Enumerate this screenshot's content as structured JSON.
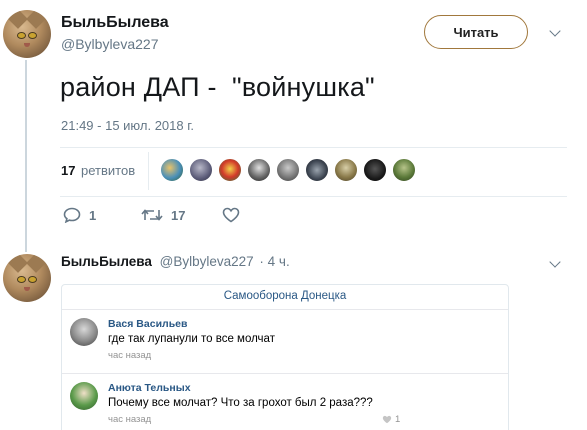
{
  "tweet": {
    "author_name": "БыльБылева",
    "author_handle": "@Bylbyleva227",
    "follow_label": "Читать",
    "text": "район ДАП -  \"войнушка\"",
    "timestamp": "21:49 - 15 июл. 2018 г.",
    "retweet_count": "17",
    "retweet_label": "ретвитов",
    "reply_count": "1",
    "retweets_action_count": "17",
    "retweeter_avatar_count_shown": 9
  },
  "reply": {
    "author_name": "БыльБылева",
    "author_handle": "@Bylbyleva227",
    "age": "· 4 ч.",
    "card": {
      "group_title": "Самооборона Донецка",
      "comments": [
        {
          "name": "Вася Васильев",
          "text": "где так лупанули то все молчат",
          "time": "час назад"
        },
        {
          "name": "Анюта Тельных",
          "text": "Почему все молчат? Что за грохот был 2 раза???",
          "time": "час назад",
          "likes": "1"
        }
      ]
    }
  },
  "colors": {
    "accent": "#1da1f2",
    "follow_border": "#a1783c",
    "muted": "#657786",
    "vk_link": "#2a5885"
  }
}
